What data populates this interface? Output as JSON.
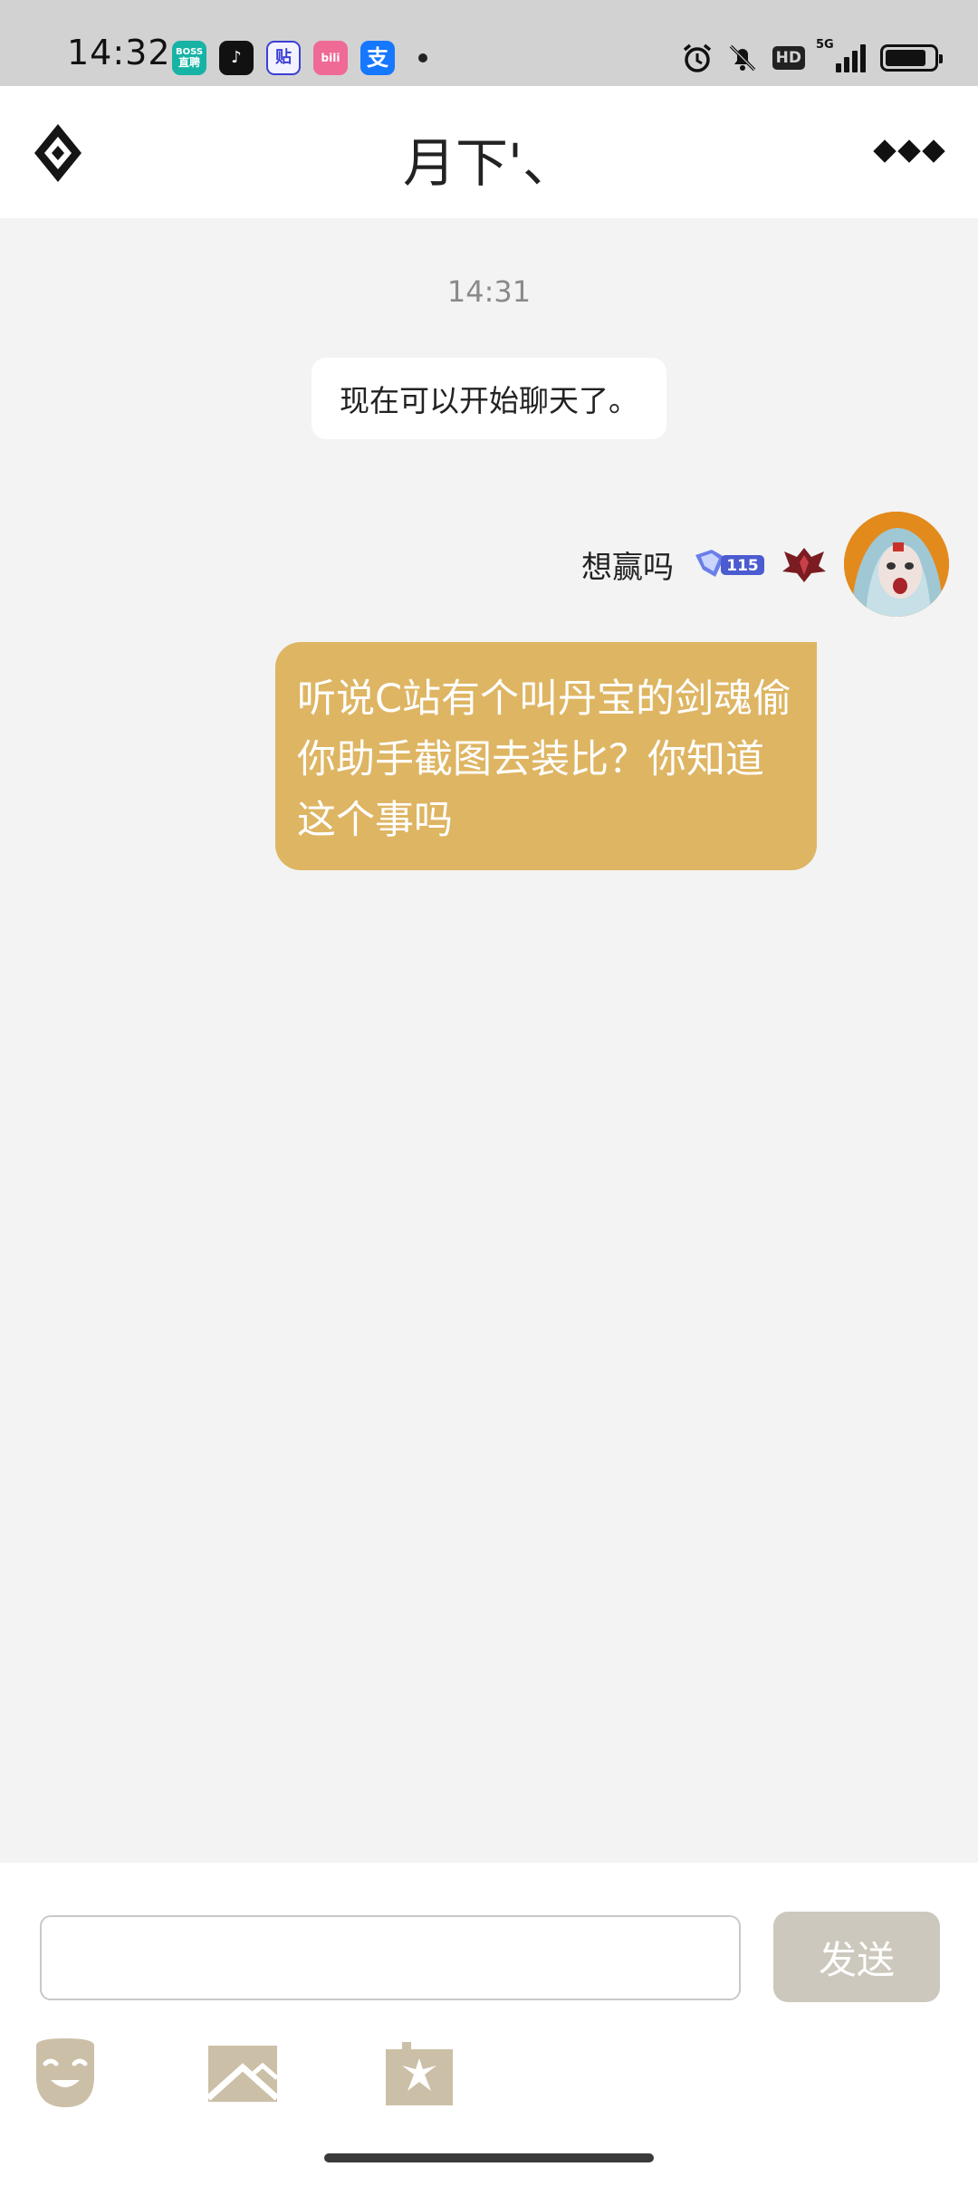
{
  "status_bar": {
    "time": "14:32",
    "notification_apps": [
      {
        "name": "boss-zhipin",
        "label": "BOSS直聘"
      },
      {
        "name": "tiktok",
        "label": "♪"
      },
      {
        "name": "tieba",
        "label": "贴"
      },
      {
        "name": "bilibili",
        "label": "bili"
      },
      {
        "name": "alipay",
        "label": "支"
      }
    ],
    "network_label": "5G",
    "hd_label": "HD",
    "battery_level": 0.85
  },
  "header": {
    "title": "月下'、"
  },
  "chat": {
    "timestamp": "14:31",
    "system_message": "现在可以开始聊天了。",
    "sender": {
      "name": "想赢吗",
      "rank_level": "115"
    },
    "message": "听说C站有个叫丹宝的剑魂偷你助手截图去装比？你知道这个事吗"
  },
  "input": {
    "value": "",
    "placeholder": "",
    "send_label": "发送"
  },
  "colors": {
    "bubble": "#deb563",
    "send_button": "#cdc8bd",
    "tool_icons": "#cbbfa7"
  }
}
